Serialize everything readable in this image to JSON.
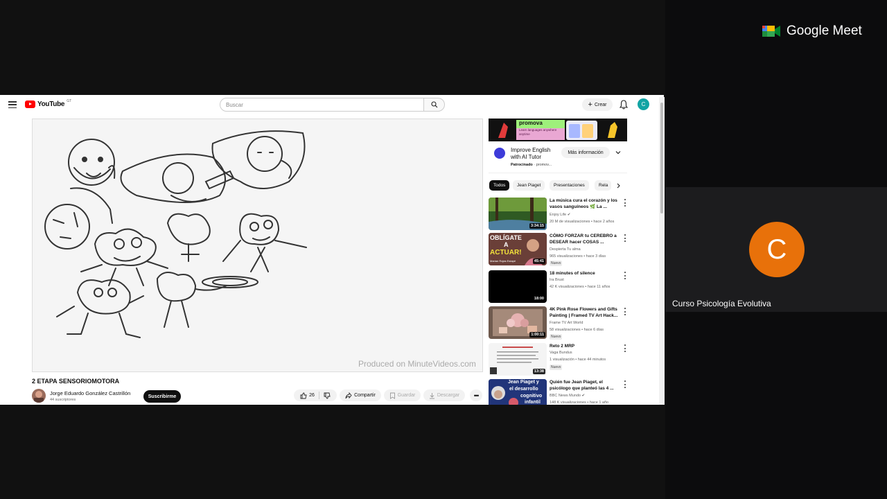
{
  "meet": {
    "logo_text": "Google Meet",
    "participant_initial": "C",
    "participant_name": "Curso Psicología Evolutiva"
  },
  "youtube": {
    "logo_text": "YouTube",
    "logo_superscript": "GT",
    "search_placeholder": "Buscar",
    "create_label": "Crear",
    "user_initial": "C",
    "video": {
      "watermark": "Produced on MinuteVideos.com",
      "title": "2 ETAPA SENSORIOMOTORA",
      "channel_name": "Jorge Eduardo González Castrillón",
      "subscribers": "44 suscriptores",
      "subscribe_label": "Suscribirme",
      "likes": "26",
      "share_label": "Compartir",
      "save_label": "Guardar",
      "download_label": "Descargar"
    },
    "ad": {
      "brand": "promova",
      "tagline": "Learn languages anywhere anytime",
      "title": "Improve English with AI Tutor",
      "sponsored": "Patrocinado",
      "sponsor_name": "promov...",
      "cta": "Más información"
    },
    "chips": [
      "Todos",
      "Jean Piaget",
      "Presentaciones",
      "Rela"
    ],
    "recommendations": [
      {
        "title": "La música cura el corazón y los vasos sanguíneos 🌿 La ...",
        "channel": "Enjoy Life",
        "meta": "20 M de visualizaciones • hace 2 años",
        "duration": "3:34:15",
        "badge": ""
      },
      {
        "title": "CÓMO FORZAR tu CEREBRO a DESEAR hacer COSAS ...",
        "channel": "Despierta Tu alma",
        "meta": "965 visualizaciones • hace 3 días",
        "duration": "45:41",
        "badge": "Nuevo",
        "thumb_text_1": "OBLÍGATE",
        "thumb_text_2": "A",
        "thumb_text_3": "ACTUAR!",
        "thumb_text_4": "Marian Rojas Estapé"
      },
      {
        "title": "18 minutes of silence",
        "channel": "Ira Brust",
        "meta": "42 K visualizaciones • hace 11 años",
        "duration": "18:00",
        "badge": ""
      },
      {
        "title": "4K Pink Rose Flowers and Gifts Painting | Framed TV Art Hack...",
        "channel": "Frame TV Art World",
        "meta": "58 visualizaciones • hace 6 días",
        "duration": "1:00:11",
        "badge": "Nuevo"
      },
      {
        "title": "Reto 2 MRP",
        "channel": "Vaga Bundus",
        "meta": "1 visualización • hace 44 minutos",
        "duration": "13:38",
        "badge": "Nuevo"
      },
      {
        "title": "Quién fue Jean Piaget, el psicólogo que planteó las 4 ...",
        "channel": "BBC News Mundo",
        "meta": "148 K visualizaciones • hace 1 año",
        "duration": "",
        "badge": "",
        "thumb_text_1": "Jean Piaget y",
        "thumb_text_2": "el desarrollo",
        "thumb_text_3": "cognitivo",
        "thumb_text_4": "infantil"
      }
    ]
  }
}
